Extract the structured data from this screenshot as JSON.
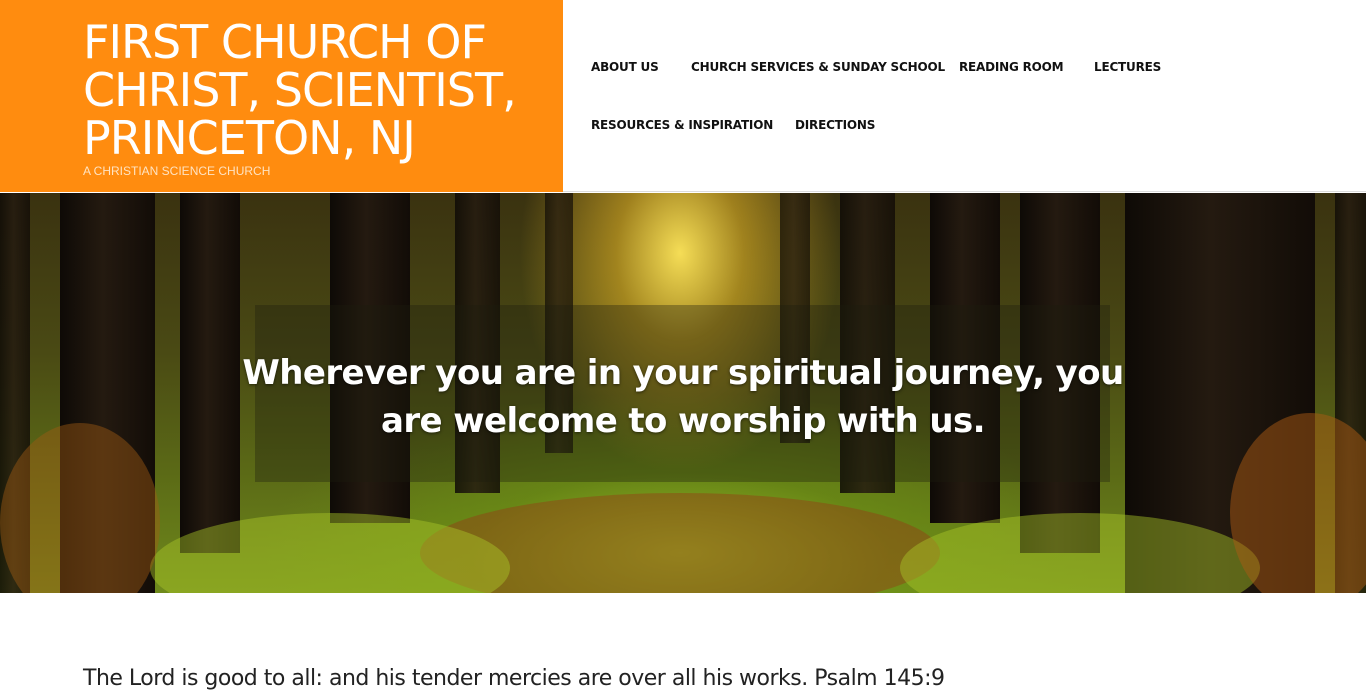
{
  "site": {
    "title": "FIRST CHURCH OF CHRIST, SCIENTIST, PRINCETON, NJ",
    "tagline": "A CHRISTIAN SCIENCE CHURCH"
  },
  "nav": {
    "items": [
      {
        "label": "ABOUT US"
      },
      {
        "label": "CHURCH SERVICES & SUNDAY SCHOOL"
      },
      {
        "label": "READING ROOM"
      },
      {
        "label": "LECTURES"
      },
      {
        "label": "RESOURCES & INSPIRATION"
      },
      {
        "label": "DIRECTIONS"
      }
    ]
  },
  "hero": {
    "text": "Wherever you are in your spiritual journey, you are welcome to worship with us."
  },
  "content": {
    "verse": "The Lord is good to all: and his tender mercies are over all his works. Psalm 145:9"
  },
  "colors": {
    "brand": "#ff8c0f",
    "nav_text": "#111111",
    "hero_text": "#ffffff"
  }
}
